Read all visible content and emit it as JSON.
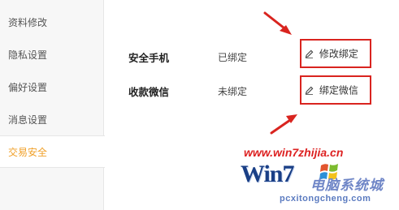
{
  "sidebar": {
    "items": [
      {
        "label": "资料修改",
        "active": false
      },
      {
        "label": "隐私设置",
        "active": false
      },
      {
        "label": "偏好设置",
        "active": false
      },
      {
        "label": "消息设置",
        "active": false
      },
      {
        "label": "交易安全",
        "active": true
      }
    ]
  },
  "security": {
    "rows": [
      {
        "label": "安全手机",
        "status": "已绑定",
        "action": "修改绑定"
      },
      {
        "label": "收款微信",
        "status": "未绑定",
        "action": "绑定微信"
      }
    ]
  },
  "watermark": {
    "url": "www.win7zhijia.cn",
    "logo": "Win7",
    "brand": "电脑系统城",
    "site": "pcxitongcheng.com"
  },
  "colors": {
    "active_text": "#f0a028",
    "annotation_red": "#d9241f",
    "sidebar_bg": "#f7f7f7"
  },
  "icons": {
    "action_icon": "pencil-icon",
    "annotation": "red-arrow"
  }
}
